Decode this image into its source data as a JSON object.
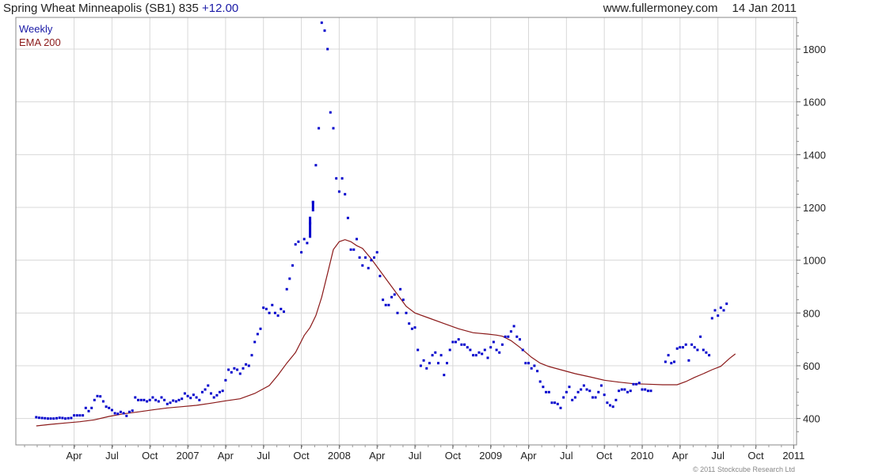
{
  "header": {
    "instrument": "Spring Wheat Minneapolis (SB1) 835",
    "change": "+12.00",
    "website": "www.fullermoney.com",
    "date": "14 Jan 2011"
  },
  "copyright": "© 2011 Stockcube Research Ltd",
  "colors": {
    "weekly": "#0000cc",
    "ema": "#8b1a1a",
    "grid": "#d8d8d8",
    "frame": "#888888"
  },
  "chart_data": {
    "type": "line",
    "x_unit": "week index (week 0 = first week of Jan 2006)",
    "ylim": [
      300,
      1920
    ],
    "yticks": [
      400,
      600,
      800,
      1000,
      1200,
      1400,
      1600,
      1800
    ],
    "xticks": [
      {
        "label": "Apr",
        "week": 13
      },
      {
        "label": "Jul",
        "week": 26
      },
      {
        "label": "Oct",
        "week": 39
      },
      {
        "label": "2007",
        "week": 52
      },
      {
        "label": "Apr",
        "week": 65
      },
      {
        "label": "Jul",
        "week": 78
      },
      {
        "label": "Oct",
        "week": 91
      },
      {
        "label": "2008",
        "week": 104
      },
      {
        "label": "Apr",
        "week": 117
      },
      {
        "label": "Jul",
        "week": 130
      },
      {
        "label": "Oct",
        "week": 143
      },
      {
        "label": "2009",
        "week": 156
      },
      {
        "label": "Apr",
        "week": 169
      },
      {
        "label": "Jul",
        "week": 182
      },
      {
        "label": "Oct",
        "week": 195
      },
      {
        "label": "2010",
        "week": 208
      },
      {
        "label": "Apr",
        "week": 221
      },
      {
        "label": "Jul",
        "week": 234
      },
      {
        "label": "Oct",
        "week": 247
      },
      {
        "label": "2011",
        "week": 260
      }
    ],
    "series": [
      {
        "name": "Weekly",
        "style": "markers",
        "points": [
          [
            0,
            405
          ],
          [
            1,
            403
          ],
          [
            2,
            402
          ],
          [
            3,
            401
          ],
          [
            4,
            400
          ],
          [
            5,
            400
          ],
          [
            6,
            400
          ],
          [
            7,
            401
          ],
          [
            8,
            403
          ],
          [
            9,
            402
          ],
          [
            10,
            400
          ],
          [
            11,
            401
          ],
          [
            12,
            402
          ],
          [
            13,
            412
          ],
          [
            14,
            412
          ],
          [
            15,
            412
          ],
          [
            16,
            412
          ],
          [
            17,
            440
          ],
          [
            18,
            428
          ],
          [
            19,
            440
          ],
          [
            20,
            470
          ],
          [
            21,
            485
          ],
          [
            22,
            484
          ],
          [
            23,
            465
          ],
          [
            24,
            445
          ],
          [
            25,
            440
          ],
          [
            26,
            432
          ],
          [
            27,
            420
          ],
          [
            28,
            418
          ],
          [
            29,
            425
          ],
          [
            30,
            420
          ],
          [
            31,
            410
          ],
          [
            32,
            425
          ],
          [
            33,
            430
          ],
          [
            34,
            480
          ],
          [
            35,
            470
          ],
          [
            36,
            470
          ],
          [
            37,
            470
          ],
          [
            38,
            465
          ],
          [
            39,
            470
          ],
          [
            40,
            480
          ],
          [
            41,
            470
          ],
          [
            42,
            465
          ],
          [
            43,
            480
          ],
          [
            44,
            470
          ],
          [
            45,
            455
          ],
          [
            46,
            460
          ],
          [
            47,
            468
          ],
          [
            48,
            465
          ],
          [
            49,
            470
          ],
          [
            50,
            475
          ],
          [
            51,
            495
          ],
          [
            52,
            485
          ],
          [
            53,
            478
          ],
          [
            54,
            490
          ],
          [
            55,
            480
          ],
          [
            56,
            470
          ],
          [
            57,
            500
          ],
          [
            58,
            510
          ],
          [
            59,
            525
          ],
          [
            60,
            495
          ],
          [
            61,
            480
          ],
          [
            62,
            488
          ],
          [
            63,
            500
          ],
          [
            64,
            505
          ],
          [
            65,
            545
          ],
          [
            66,
            585
          ],
          [
            67,
            575
          ],
          [
            68,
            590
          ],
          [
            69,
            585
          ],
          [
            70,
            570
          ],
          [
            71,
            590
          ],
          [
            72,
            605
          ],
          [
            73,
            600
          ],
          [
            74,
            640
          ],
          [
            75,
            690
          ],
          [
            76,
            720
          ],
          [
            77,
            740
          ],
          [
            78,
            820
          ],
          [
            79,
            815
          ],
          [
            80,
            800
          ],
          [
            81,
            830
          ],
          [
            82,
            800
          ],
          [
            83,
            790
          ],
          [
            84,
            815
          ],
          [
            85,
            805
          ],
          [
            86,
            890
          ],
          [
            87,
            930
          ],
          [
            88,
            980
          ],
          [
            89,
            1060
          ],
          [
            90,
            1070
          ],
          [
            91,
            1030
          ],
          [
            92,
            1080
          ],
          [
            93,
            1065
          ],
          [
            94,
            1140
          ],
          [
            95,
            1220
          ],
          [
            96,
            1360
          ],
          [
            97,
            1500
          ],
          [
            98,
            1900
          ],
          [
            99,
            1870
          ],
          [
            100,
            1800
          ],
          [
            101,
            1560
          ],
          [
            102,
            1500
          ],
          [
            103,
            1310
          ],
          [
            104,
            1260
          ],
          [
            105,
            1310
          ],
          [
            106,
            1250
          ],
          [
            107,
            1160
          ],
          [
            108,
            1040
          ],
          [
            109,
            1040
          ],
          [
            110,
            1080
          ],
          [
            111,
            1010
          ],
          [
            112,
            980
          ],
          [
            113,
            1010
          ],
          [
            114,
            970
          ],
          [
            115,
            1000
          ],
          [
            116,
            1010
          ],
          [
            117,
            1030
          ],
          [
            118,
            940
          ],
          [
            119,
            850
          ],
          [
            120,
            830
          ],
          [
            121,
            830
          ],
          [
            122,
            860
          ],
          [
            123,
            870
          ],
          [
            124,
            800
          ],
          [
            125,
            890
          ],
          [
            126,
            850
          ],
          [
            127,
            800
          ],
          [
            128,
            760
          ],
          [
            129,
            740
          ],
          [
            130,
            745
          ],
          [
            131,
            660
          ],
          [
            132,
            600
          ],
          [
            133,
            620
          ],
          [
            134,
            590
          ],
          [
            135,
            610
          ],
          [
            136,
            640
          ],
          [
            137,
            650
          ],
          [
            138,
            610
          ],
          [
            139,
            640
          ],
          [
            140,
            565
          ],
          [
            141,
            610
          ],
          [
            142,
            660
          ],
          [
            143,
            690
          ],
          [
            144,
            690
          ],
          [
            145,
            700
          ],
          [
            146,
            680
          ],
          [
            147,
            680
          ],
          [
            148,
            670
          ],
          [
            149,
            660
          ],
          [
            150,
            640
          ],
          [
            151,
            640
          ],
          [
            152,
            650
          ],
          [
            153,
            645
          ],
          [
            154,
            660
          ],
          [
            155,
            630
          ],
          [
            156,
            670
          ],
          [
            157,
            690
          ],
          [
            158,
            660
          ],
          [
            159,
            650
          ],
          [
            160,
            680
          ],
          [
            161,
            710
          ],
          [
            162,
            710
          ],
          [
            163,
            730
          ],
          [
            164,
            750
          ],
          [
            165,
            710
          ],
          [
            166,
            700
          ],
          [
            167,
            660
          ],
          [
            168,
            610
          ],
          [
            169,
            610
          ],
          [
            170,
            590
          ],
          [
            171,
            600
          ],
          [
            172,
            580
          ],
          [
            173,
            540
          ],
          [
            174,
            520
          ],
          [
            175,
            500
          ],
          [
            176,
            500
          ],
          [
            177,
            460
          ],
          [
            178,
            460
          ],
          [
            179,
            455
          ],
          [
            180,
            440
          ],
          [
            181,
            480
          ],
          [
            182,
            500
          ],
          [
            183,
            520
          ],
          [
            184,
            470
          ],
          [
            185,
            480
          ],
          [
            186,
            500
          ],
          [
            187,
            510
          ],
          [
            188,
            525
          ],
          [
            189,
            510
          ],
          [
            190,
            505
          ],
          [
            191,
            480
          ],
          [
            192,
            480
          ],
          [
            193,
            500
          ],
          [
            194,
            525
          ],
          [
            195,
            490
          ],
          [
            196,
            460
          ],
          [
            197,
            450
          ],
          [
            198,
            445
          ],
          [
            199,
            470
          ],
          [
            200,
            505
          ],
          [
            201,
            510
          ],
          [
            202,
            510
          ],
          [
            203,
            500
          ],
          [
            204,
            505
          ],
          [
            205,
            530
          ],
          [
            206,
            530
          ],
          [
            207,
            535
          ],
          [
            208,
            510
          ],
          [
            209,
            510
          ],
          [
            210,
            505
          ],
          [
            211,
            505
          ],
          [
            216,
            615
          ],
          [
            217,
            640
          ],
          [
            218,
            610
          ],
          [
            219,
            615
          ],
          [
            220,
            665
          ],
          [
            221,
            670
          ],
          [
            222,
            670
          ],
          [
            223,
            680
          ],
          [
            224,
            620
          ],
          [
            225,
            680
          ],
          [
            226,
            670
          ],
          [
            227,
            660
          ],
          [
            228,
            710
          ],
          [
            229,
            660
          ],
          [
            230,
            650
          ],
          [
            231,
            640
          ],
          [
            232,
            780
          ],
          [
            233,
            810
          ],
          [
            234,
            790
          ],
          [
            235,
            820
          ],
          [
            236,
            810
          ],
          [
            237,
            835
          ]
        ]
      },
      {
        "name": "EMA 200",
        "style": "line",
        "points": [
          [
            0,
            372
          ],
          [
            5,
            378
          ],
          [
            10,
            383
          ],
          [
            15,
            388
          ],
          [
            20,
            395
          ],
          [
            25,
            408
          ],
          [
            30,
            418
          ],
          [
            35,
            425
          ],
          [
            40,
            433
          ],
          [
            45,
            440
          ],
          [
            50,
            445
          ],
          [
            55,
            450
          ],
          [
            60,
            458
          ],
          [
            65,
            467
          ],
          [
            70,
            475
          ],
          [
            75,
            495
          ],
          [
            80,
            525
          ],
          [
            83,
            565
          ],
          [
            86,
            610
          ],
          [
            89,
            650
          ],
          [
            92,
            715
          ],
          [
            94,
            745
          ],
          [
            96,
            790
          ],
          [
            98,
            860
          ],
          [
            100,
            950
          ],
          [
            102,
            1040
          ],
          [
            104,
            1070
          ],
          [
            106,
            1078
          ],
          [
            108,
            1070
          ],
          [
            110,
            1055
          ],
          [
            112,
            1045
          ],
          [
            115,
            1005
          ],
          [
            118,
            960
          ],
          [
            121,
            915
          ],
          [
            124,
            870
          ],
          [
            127,
            825
          ],
          [
            130,
            800
          ],
          [
            135,
            780
          ],
          [
            140,
            760
          ],
          [
            145,
            740
          ],
          [
            150,
            725
          ],
          [
            155,
            720
          ],
          [
            158,
            716
          ],
          [
            160,
            712
          ],
          [
            163,
            695
          ],
          [
            166,
            670
          ],
          [
            170,
            632
          ],
          [
            173,
            610
          ],
          [
            176,
            597
          ],
          [
            180,
            585
          ],
          [
            185,
            570
          ],
          [
            190,
            558
          ],
          [
            195,
            545
          ],
          [
            200,
            538
          ],
          [
            205,
            532
          ],
          [
            210,
            530
          ],
          [
            215,
            528
          ],
          [
            220,
            528
          ],
          [
            223,
            540
          ],
          [
            226,
            556
          ],
          [
            229,
            570
          ],
          [
            232,
            585
          ],
          [
            235,
            598
          ],
          [
            238,
            628
          ],
          [
            240,
            645
          ]
        ]
      }
    ]
  }
}
